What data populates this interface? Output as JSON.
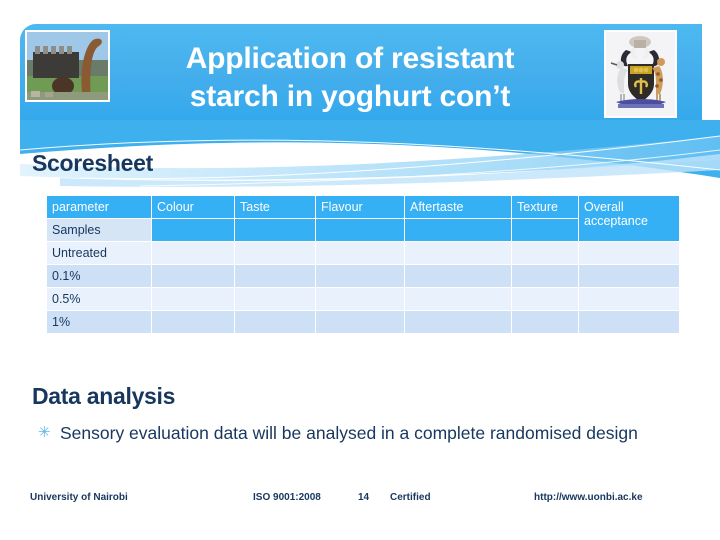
{
  "slide": {
    "title_line1": "Application of resistant",
    "title_line2": "starch in yoghurt con’t",
    "scoresheet_heading": "Scoresheet",
    "data_analysis_heading": "Data analysis",
    "banner_image_left": "university-monument-photo",
    "banner_image_right": "university-coat-of-arms"
  },
  "table": {
    "corner_label": "parameter",
    "row_header_label": "Samples",
    "columns": [
      "Colour",
      "Taste",
      "Flavour",
      "Aftertaste",
      "Texture",
      "Overall acceptance"
    ],
    "rows": [
      {
        "label": "Untreated",
        "cells": [
          "",
          "",
          "",
          "",
          "",
          ""
        ]
      },
      {
        "label": "0.1%",
        "cells": [
          "",
          "",
          "",
          "",
          "",
          ""
        ]
      },
      {
        "label": "0.5%",
        "cells": [
          "",
          "",
          "",
          "",
          "",
          ""
        ]
      },
      {
        "label": "1%",
        "cells": [
          "",
          "",
          "",
          "",
          "",
          ""
        ]
      }
    ]
  },
  "bullets": [
    {
      "mark": "✳",
      "text": "Sensory evaluation data will be analysed in a complete randomised design"
    }
  ],
  "footer": {
    "organisation": "University of Nairobi",
    "iso": "ISO 9001:2008",
    "slide_number": "14",
    "certified": "Certified",
    "url": "http://www.uonbi.ac.ke"
  },
  "colors": {
    "banner_blue": "#45aeec",
    "header_cell_blue": "#35b0f5",
    "row_light": "#e9f1fc",
    "row_dark": "#cde0f5",
    "samples_cell": "#d5e5f6",
    "text_navy": "#17375e",
    "bullet_blue": "#5bb9e8"
  }
}
